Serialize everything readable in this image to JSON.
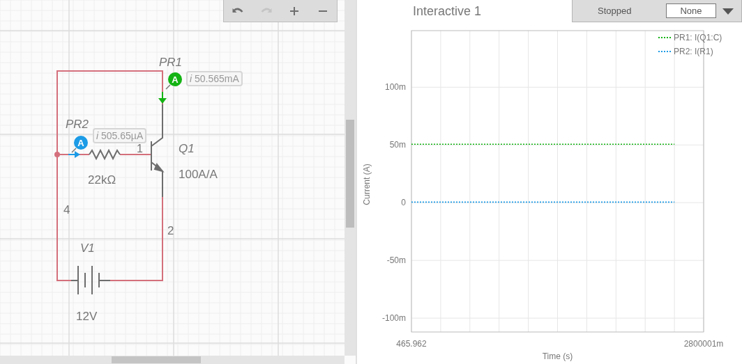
{
  "toolbar": {
    "buttons": [
      {
        "kind": "undo",
        "disabled": false
      },
      {
        "kind": "redo",
        "disabled": true
      },
      {
        "kind": "zoom-in",
        "disabled": false
      },
      {
        "kind": "zoom-out",
        "disabled": false
      }
    ]
  },
  "circuit": {
    "probes": [
      {
        "name": "PR1",
        "badge": "A",
        "reading": "*i* 50.565mA",
        "color": "#13b313"
      },
      {
        "name": "PR2",
        "badge": "A",
        "reading": "*i* 505.65µA",
        "color": "#1c9be6"
      }
    ],
    "transistor": {
      "name": "Q1",
      "gain": "100A/A",
      "pin": "1"
    },
    "resistor": {
      "value": "22kΩ"
    },
    "source": {
      "name": "V1",
      "value": "12V"
    },
    "nets": [
      "4",
      "2"
    ]
  },
  "panel": {
    "title": "Interactive 1",
    "status": "Stopped",
    "select": {
      "value": "None"
    },
    "chart_data": {
      "type": "line",
      "xlabel": "Time (s)",
      "ylabel": "Current (A)",
      "grid": true,
      "legend": true,
      "categories": [
        "465.962",
        null,
        null,
        null,
        null,
        null,
        null,
        null,
        null,
        null,
        "2800001m"
      ],
      "ylim": [
        -112,
        149
      ],
      "yticks": [
        {
          "value": 100,
          "label": "100m"
        },
        {
          "value": 50,
          "label": "50m"
        },
        {
          "value": 0,
          "label": "0"
        },
        {
          "value": -50,
          "label": "-50m"
        },
        {
          "value": -100,
          "label": "-100m"
        }
      ],
      "series": [
        {
          "name": "PR1: I(Q1:C)",
          "color": "#13b313",
          "line_style": "dotted",
          "values": [
            50.6,
            50.6,
            50.6,
            50.6,
            50.6,
            50.6,
            50.6,
            50.6,
            50.6,
            50.6,
            null
          ]
        },
        {
          "name": "PR2: I(R1)",
          "color": "#1c9be6",
          "line_style": "dotted",
          "values": [
            0.5,
            0.5,
            0.5,
            0.5,
            0.5,
            0.5,
            0.5,
            0.5,
            0.5,
            0.5,
            null
          ]
        }
      ]
    }
  }
}
